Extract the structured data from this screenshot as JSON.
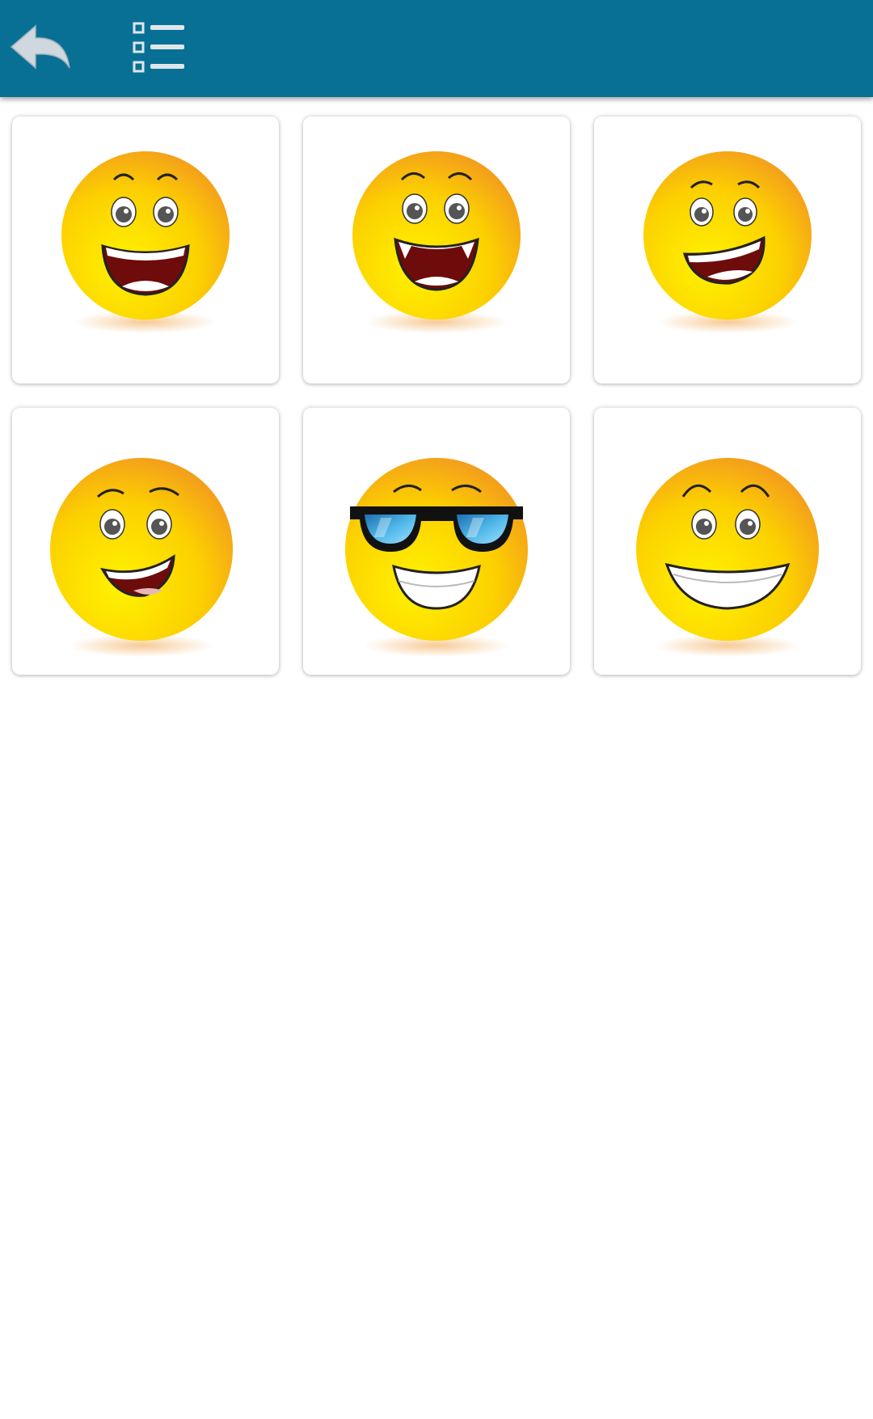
{
  "toolbar": {
    "background": "#087095",
    "back_icon": "back-arrow-icon",
    "menu_icon": "list-icon"
  },
  "emojis": [
    {
      "name": "laughing",
      "icon": "laughing-smiley-icon"
    },
    {
      "name": "laughing-fangs",
      "icon": "laughing-fangs-smiley-icon"
    },
    {
      "name": "laughing-wide",
      "icon": "laughing-wide-smiley-icon"
    },
    {
      "name": "smirk",
      "icon": "smirk-smiley-icon"
    },
    {
      "name": "sunglasses",
      "icon": "sunglasses-smiley-icon"
    },
    {
      "name": "grin",
      "icon": "grin-smiley-icon"
    }
  ],
  "colors": {
    "face_light": "#fff200",
    "face_dark": "#f6a21c",
    "mouth": "#6e0b0b",
    "lens": "#4fb6e8"
  }
}
